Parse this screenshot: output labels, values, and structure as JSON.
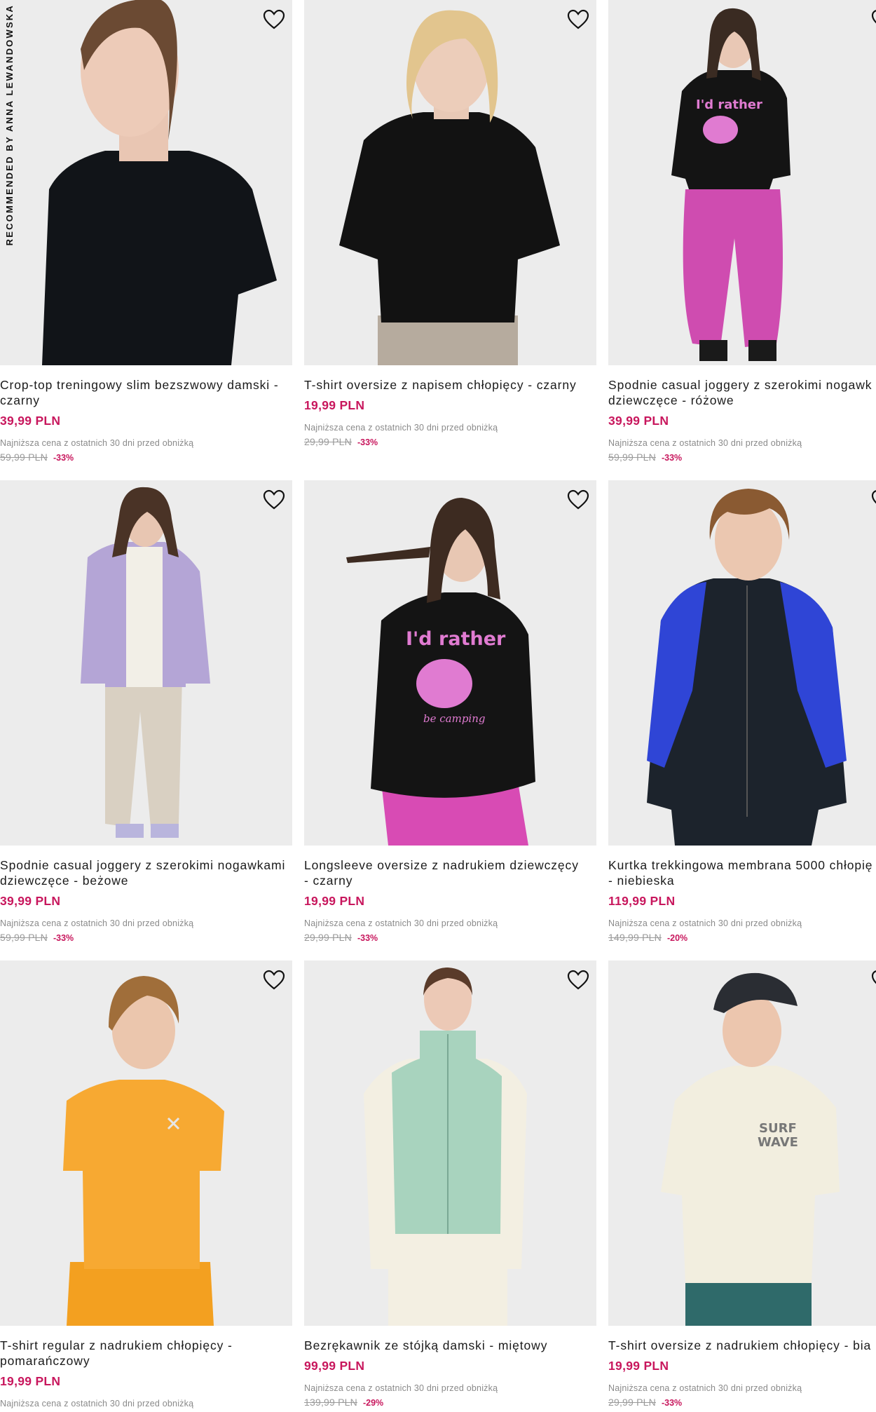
{
  "badge_text": "RECOMMENDED BY ANNA LEWANDOWSKA",
  "lowest_label": "Najniższa cena z ostatnich 30 dni przed obniżką",
  "colors": {
    "accent": "#c8175d",
    "background": "#ececec"
  },
  "products": [
    {
      "name": "Crop-top treningowy slim bezszwowy damski -",
      "name2": "czarny",
      "price": "39,99 PLN",
      "old_price": "59,99 PLN",
      "discount": "-33%"
    },
    {
      "name": "T-shirt oversize z napisem chłopięcy - czarny",
      "name2": "",
      "price": "19,99 PLN",
      "old_price": "29,99 PLN",
      "discount": "-33%"
    },
    {
      "name": "Spodnie casual joggery z szerokimi nogawk",
      "name2": "dziewczęce - różowe",
      "price": "39,99 PLN",
      "old_price": "59,99 PLN",
      "discount": "-33%"
    },
    {
      "name": "Spodnie casual joggery z szerokimi nogawkami",
      "name2": "dziewczęce - beżowe",
      "price": "39,99 PLN",
      "old_price": "59,99 PLN",
      "discount": "-33%"
    },
    {
      "name": "Longsleeve oversize z nadrukiem dziewczęcy",
      "name2": "- czarny",
      "price": "19,99 PLN",
      "old_price": "29,99 PLN",
      "discount": "-33%"
    },
    {
      "name": "Kurtka trekkingowa membrana 5000 chłopię",
      "name2": "- niebieska",
      "price": "119,99 PLN",
      "old_price": "149,99 PLN",
      "discount": "-20%"
    },
    {
      "name": "T-shirt regular z nadrukiem chłopięcy -",
      "name2": "pomarańczowy",
      "price": "19,99 PLN",
      "old_price": "",
      "discount": ""
    },
    {
      "name": "Bezrękawnik ze stójką damski - miętowy",
      "name2": "",
      "price": "99,99 PLN",
      "old_price": "139,99 PLN",
      "discount": "-29%"
    },
    {
      "name": "T-shirt oversize z nadrukiem chłopięcy - bia",
      "name2": "",
      "price": "19,99 PLN",
      "old_price": "29,99 PLN",
      "discount": "-33%"
    }
  ],
  "prints": {
    "rather": "I'd rather",
    "camping": "be camping",
    "surf": "SURF",
    "wave": "WAVE"
  }
}
